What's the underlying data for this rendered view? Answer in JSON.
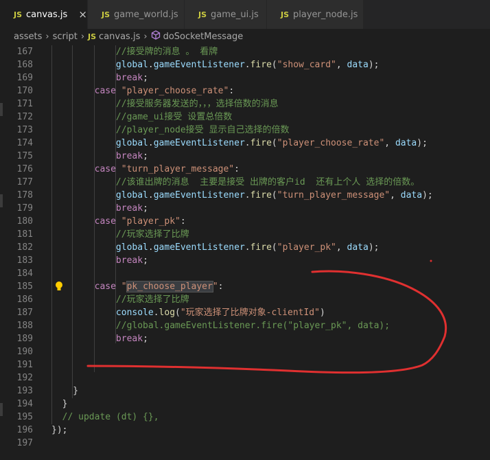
{
  "tabs": [
    {
      "label": "canvas.js",
      "icon": "js-file-icon",
      "active": true
    },
    {
      "label": "game_world.js",
      "icon": "js-file-icon",
      "active": false
    },
    {
      "label": "game_ui.js",
      "icon": "js-file-icon",
      "active": false
    },
    {
      "label": "player_node.js",
      "icon": "js-file-icon",
      "active": false
    }
  ],
  "breadcrumb": {
    "items": [
      "assets",
      "script",
      "canvas.js",
      "doSocketMessage"
    ]
  },
  "icons": {
    "js": "JS",
    "close": "×",
    "chevron": "›",
    "method": "method-icon",
    "bulb": "lightbulb-icon"
  },
  "code": {
    "lines": [
      {
        "n": "167",
        "text": "            //接受牌的消息 。 看牌"
      },
      {
        "n": "168",
        "text": "            global.gameEventListener.fire(\"show_card\", data);"
      },
      {
        "n": "169",
        "text": "            break;"
      },
      {
        "n": "170",
        "text": "        case \"player_choose_rate\":"
      },
      {
        "n": "171",
        "text": "            //接受服务器发送的，，，选择倍数的消息"
      },
      {
        "n": "172",
        "text": "            //game_ui接受 设置总倍数"
      },
      {
        "n": "173",
        "text": "            //player_node接受 显示自己选择的倍数"
      },
      {
        "n": "174",
        "text": "            global.gameEventListener.fire(\"player_choose_rate\", data);"
      },
      {
        "n": "175",
        "text": "            break;"
      },
      {
        "n": "176",
        "text": "        case \"turn_player_message\":"
      },
      {
        "n": "177",
        "text": "            //该谁出牌的消息  主要是接受 出牌的客户id  还有上个人 选择的倍数。"
      },
      {
        "n": "178",
        "text": "            global.gameEventListener.fire(\"turn_player_message\", data);"
      },
      {
        "n": "179",
        "text": "            break;"
      },
      {
        "n": "180",
        "text": "        case \"player_pk\":"
      },
      {
        "n": "181",
        "text": "            //玩家选择了比牌"
      },
      {
        "n": "182",
        "text": "            global.gameEventListener.fire(\"player_pk\", data);"
      },
      {
        "n": "183",
        "text": "            break;"
      },
      {
        "n": "184",
        "text": ""
      },
      {
        "n": "185",
        "text": "        case \"pk_choose_player\":"
      },
      {
        "n": "186",
        "text": "            //玩家选择了比牌"
      },
      {
        "n": "187",
        "text": "            console.log(\"玩家选择了比牌对象-clientId\")"
      },
      {
        "n": "188",
        "text": "            //global.gameEventListener.fire(\"player_pk\", data);"
      },
      {
        "n": "189",
        "text": "            break;"
      },
      {
        "n": "190",
        "text": ""
      },
      {
        "n": "191",
        "text": ""
      },
      {
        "n": "192",
        "text": ""
      },
      {
        "n": "193",
        "text": "    }"
      },
      {
        "n": "194",
        "text": "  }"
      },
      {
        "n": "195",
        "text": "  // update (dt) {},"
      },
      {
        "n": "196",
        "text": "});"
      },
      {
        "n": "197",
        "text": ""
      }
    ]
  },
  "colors": {
    "keyword": "#c586c0",
    "string": "#ce9178",
    "comment": "#6a9955",
    "variable": "#9cdcfe",
    "function": "#dcdcaa",
    "annotation": "#e03030"
  }
}
